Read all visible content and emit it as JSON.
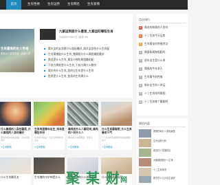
{
  "nav": {
    "tabs": [
      {
        "label": "首页"
      },
      {
        "label": "生肖性格"
      },
      {
        "label": "生肖运势"
      },
      {
        "label": "生肖网名"
      },
      {
        "label": "生肖爱情"
      }
    ]
  },
  "hero": {
    "caption": "生肖属兔的女人性格",
    "subtitle": "属兔女人温柔贤惠、善解人意"
  },
  "featured": {
    "title": "九紫运到底什么意思_九紫运旺哪些生肖",
    "meta": "2019年03月02日 (阅读 96)"
  },
  "list": [
    {
      "text": "属羊女的女孩属什么相配最好_属羊女孩找什么生肖配"
    },
    {
      "text": "生肖属猪配什么生肖_猪属相与什么属相婚配最好"
    },
    {
      "text": "属龙是什么生肖_属龙与哪些属相最相配"
    },
    {
      "text": "干枝方属蛇是什么生肖_干枝方属什么数字"
    },
    {
      "text": "属羊的什么生肖_我的出生年是什么生肖"
    },
    {
      "text": "鱼类是什么生肖_鱼类的生肖属什么"
    }
  ],
  "more_link": "更多>>",
  "cards": [
    {
      "title": "什么属相的人身材最高_什么属相的人身材最好",
      "desc": "属兔的朋友性格温顺，身材高挑修长",
      "tag": "+生肖属相"
    },
    {
      "title": "生肖鸡是哪年出生_鸡年是哪些年份",
      "desc": "生肖鸡分别是一九四五年等年份出生",
      "tag": "+生肖属相"
    },
    {
      "title": "属鸡的什么人最旺鸡_属鸡的人旺什么人",
      "desc": "属鸡的人性格要强，爱面子",
      "tag": "+生肖属相"
    },
    {
      "title": "什么生肖最聪明_什么生肖最讲义气",
      "desc": "十二生肖中最聪明的生肖是属鼠的人",
      "tag": "+生肖属相"
    }
  ],
  "bottom_cards": [
    {
      "title": "什么生肖最旺夫"
    },
    {
      "title": "生肖猪的守护神是什么"
    },
    {
      "title": "属兔的人和什么属相最配"
    },
    {
      "title": "什么属相最有福气"
    }
  ],
  "watermark": {
    "text": "聚 某 财",
    "suffix": "网"
  },
  "sidebar": {
    "heading": "点击排行",
    "items": [
      {
        "rank": "1",
        "text": "属虎的和属的人合吗",
        "color": "#e85a4f"
      },
      {
        "rank": "2",
        "text": "十二生肖今天运势",
        "color": "#f07d3c"
      },
      {
        "rank": "3",
        "text": "生肖属龙的性格特点",
        "color": "#f3a33b"
      },
      {
        "rank": "4",
        "text": "属鼠和属狗相配吗",
        "color": "#b7b7b7"
      },
      {
        "rank": "5",
        "text": "虎年出生是什么命",
        "color": "#b7b7b7"
      },
      {
        "rank": "6",
        "text": "属猴的今年多大",
        "color": "#b7b7b7"
      },
      {
        "rank": "7",
        "text": "生肖属牛的性格",
        "color": "#b7b7b7"
      },
      {
        "rank": "8",
        "text": "狗年出生的人命运",
        "color": "#b7b7b7"
      },
      {
        "rank": "9",
        "text": "十二生肖排序属相",
        "color": "#b7b7b7"
      },
      {
        "rank": "10",
        "text": "十二生肖哪个最聪明",
        "color": "#b7b7b7"
      }
    ]
  },
  "related": {
    "heading": "随机内容",
    "items": [
      {
        "text": "属猴的和什么属相最配"
      },
      {
        "text": "生肖运势分析"
      },
      {
        "text": "属鼠的人性格特点"
      },
      {
        "text": "大鹏展翅属什么生肖"
      },
      {
        "text": "十二生肖故事"
      },
      {
        "text": "属羊的人几月出生最好"
      }
    ]
  },
  "colors": {
    "accent": "#1f8bbf",
    "nav_bg": "#2a2a2a",
    "watermark": "#1d8b45"
  }
}
